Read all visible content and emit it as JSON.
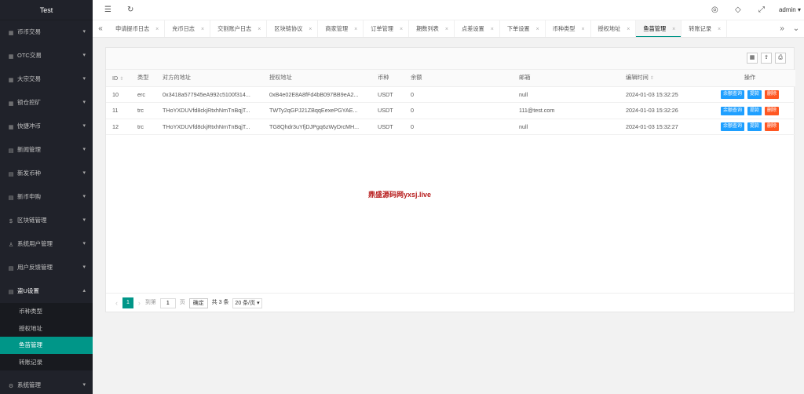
{
  "app": {
    "title": "Test"
  },
  "sidebar": {
    "items": [
      {
        "label": "币币交易",
        "icon": "grid-icon"
      },
      {
        "label": "OTC交易",
        "icon": "grid-icon"
      },
      {
        "label": "大宗交易",
        "icon": "grid-icon"
      },
      {
        "label": "锁仓挖矿",
        "icon": "grid-icon"
      },
      {
        "label": "快捷冲币",
        "icon": "grid-icon"
      },
      {
        "label": "新闻管理",
        "icon": "list-icon"
      },
      {
        "label": "新发币种",
        "icon": "list-icon"
      },
      {
        "label": "新币申购",
        "icon": "list-icon"
      },
      {
        "label": "区块链管理",
        "icon": "dollar-icon"
      },
      {
        "label": "系统用户管理",
        "icon": "user-icon"
      },
      {
        "label": "用户反馈管理",
        "icon": "list-icon"
      }
    ],
    "open_group": {
      "label": "盗U设置",
      "icon": "list-icon",
      "children": [
        "币种类型",
        "授权地址",
        "鱼苗管理",
        "转账记录"
      ],
      "active_index": 2
    },
    "bottom_item": {
      "label": "系统管理",
      "icon": "gear-icon"
    }
  },
  "header": {
    "user": "admin"
  },
  "tabs": [
    {
      "label": "申请提币日志"
    },
    {
      "label": "充币日志"
    },
    {
      "label": "交割账户日志"
    },
    {
      "label": "区块链协议"
    },
    {
      "label": "商家管理"
    },
    {
      "label": "订单管理"
    },
    {
      "label": "期数列表"
    },
    {
      "label": "点差设置"
    },
    {
      "label": "下单设置"
    },
    {
      "label": "币种类型"
    },
    {
      "label": "授权地址"
    },
    {
      "label": "鱼苗管理",
      "active": true
    },
    {
      "label": "转账记录"
    }
  ],
  "table": {
    "columns": [
      "ID",
      "类型",
      "对方的地址",
      "授权地址",
      "币种",
      "余额",
      "邮箱",
      "编辑时间",
      "操作"
    ],
    "rows": [
      {
        "id": "10",
        "type": "erc",
        "from": "0x3418a577945eA992c5100f314...",
        "auth": "0xB4e02E8A8fFd4bB097BB9eA2...",
        "coin": "USDT",
        "balance": "0",
        "email": "null",
        "time": "2024-01-03 15:32:25"
      },
      {
        "id": "11",
        "type": "trc",
        "from": "THoYXDUVfd8ckjRtxhNmTnBqjT...",
        "auth": "TWTy2qGPJ21ZBqqEexePGYAE...",
        "coin": "USDT",
        "balance": "0",
        "email": "111@test.com",
        "time": "2024-01-03 15:32:26"
      },
      {
        "id": "12",
        "type": "trc",
        "from": "THoYXDUVfd8ckjRtxhNmTnBqjT...",
        "auth": "TG8Qhdr3uYfjDJPgq6zWyDrcMH...",
        "coin": "USDT",
        "balance": "0",
        "email": "null",
        "time": "2024-01-03 15:32:27"
      }
    ],
    "actions": {
      "query": "余额查询",
      "withdraw": "提款",
      "delete": "删除"
    }
  },
  "watermark": "鼎盛源码网yxsj.live",
  "pager": {
    "current": "1",
    "goto_label": "到第",
    "goto_value": "1",
    "page_unit": "页",
    "confirm": "确定",
    "total": "共 3 条",
    "per_page": "20 条/页"
  }
}
